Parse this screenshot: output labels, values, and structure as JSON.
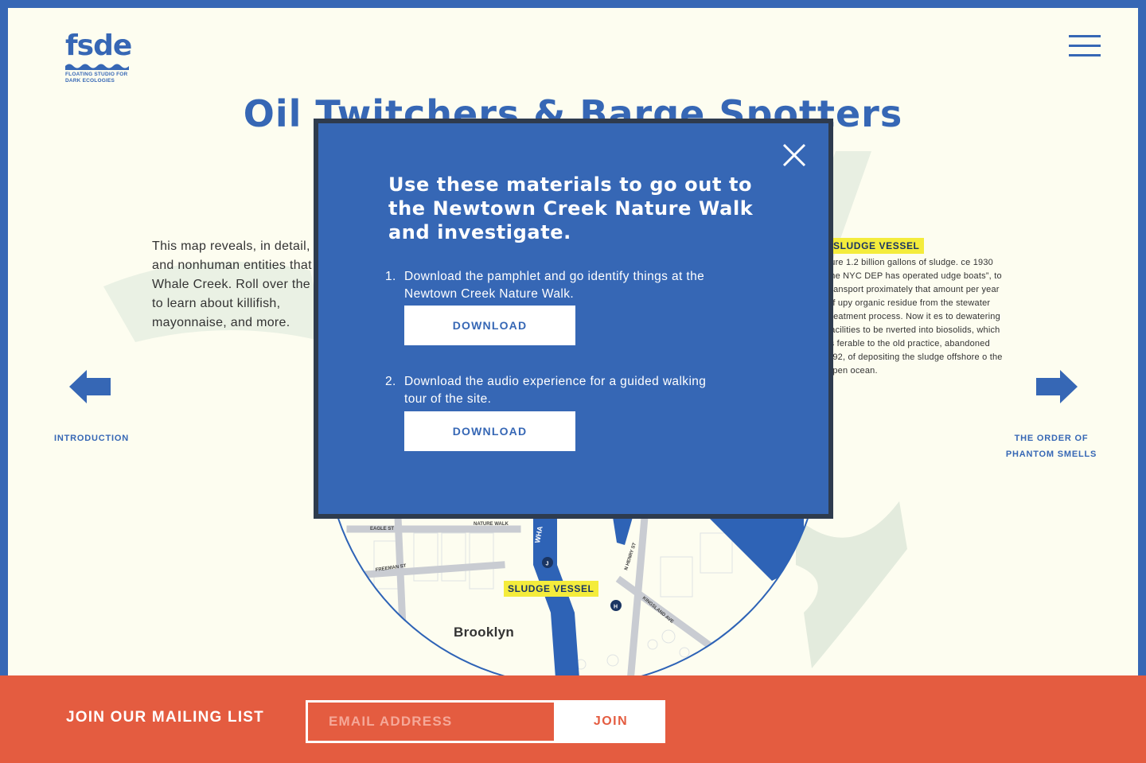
{
  "logo": {
    "mark": "fsde",
    "subtitle_line1": "FLOATING STUDIO FOR",
    "subtitle_line2": "DARK ECOLOGIES"
  },
  "menu": {
    "icon": "hamburger-menu-icon"
  },
  "page": {
    "title": "Oil Twitchers & Barge Spotters",
    "intro": "This map reveals, in detail, human and nonhuman entities that share Whale Creek.  Roll over the letters to learn about killifish, mayonnaise, and more."
  },
  "sludge": {
    "label": "SLUDGE VESSEL",
    "description": "ture 1.2 billion gallons of sludge. ce 1930 the NYC DEP has operated udge boats”, to transport proximately that amount per year of upy organic residue from the stewater treatment process.  Now it es to dewatering facilities to be nverted into biosolids, which is ferable to the old practice, abandoned 992, of depositing the sludge offshore o the open ocean."
  },
  "nav": {
    "prev_label": "INTRODUCTION",
    "next_label_line1": "THE ORDER OF",
    "next_label_line2": "PHANTOM SMELLS"
  },
  "map": {
    "streets": [
      "EAGLE ST",
      "FREEMAN ST",
      "N HENRY ST",
      "KINGSLAND AVE"
    ],
    "place": "NATURE WALK",
    "creek": "WHA",
    "markers": [
      "J",
      "H"
    ],
    "borough": "Brooklyn",
    "colors": {
      "water": "#2e63b6",
      "land": "#fdfdf0",
      "streets": "#c9ccd2",
      "faint": "#e6ece0"
    }
  },
  "modal": {
    "heading": "Use these materials to go out to the Newtown Creek Nature Walk and investigate.",
    "steps": [
      {
        "num": "1.",
        "text": "Download the pamphlet and go identify things at the Newtown Creek Nature Walk.",
        "button": "DOWNLOAD"
      },
      {
        "num": "2.",
        "text": "Download the audio experience for a guided walking tour of the site.",
        "button": "DOWNLOAD"
      }
    ]
  },
  "footer": {
    "label": "JOIN OUR MAILING LIST",
    "email_placeholder": "EMAIL ADDRESS",
    "join_label": "JOIN"
  },
  "colors": {
    "brand_blue": "#3667b5",
    "footer_red": "#e45c40",
    "highlight_yellow": "#f4ec3c",
    "cream": "#fdfdf0"
  }
}
